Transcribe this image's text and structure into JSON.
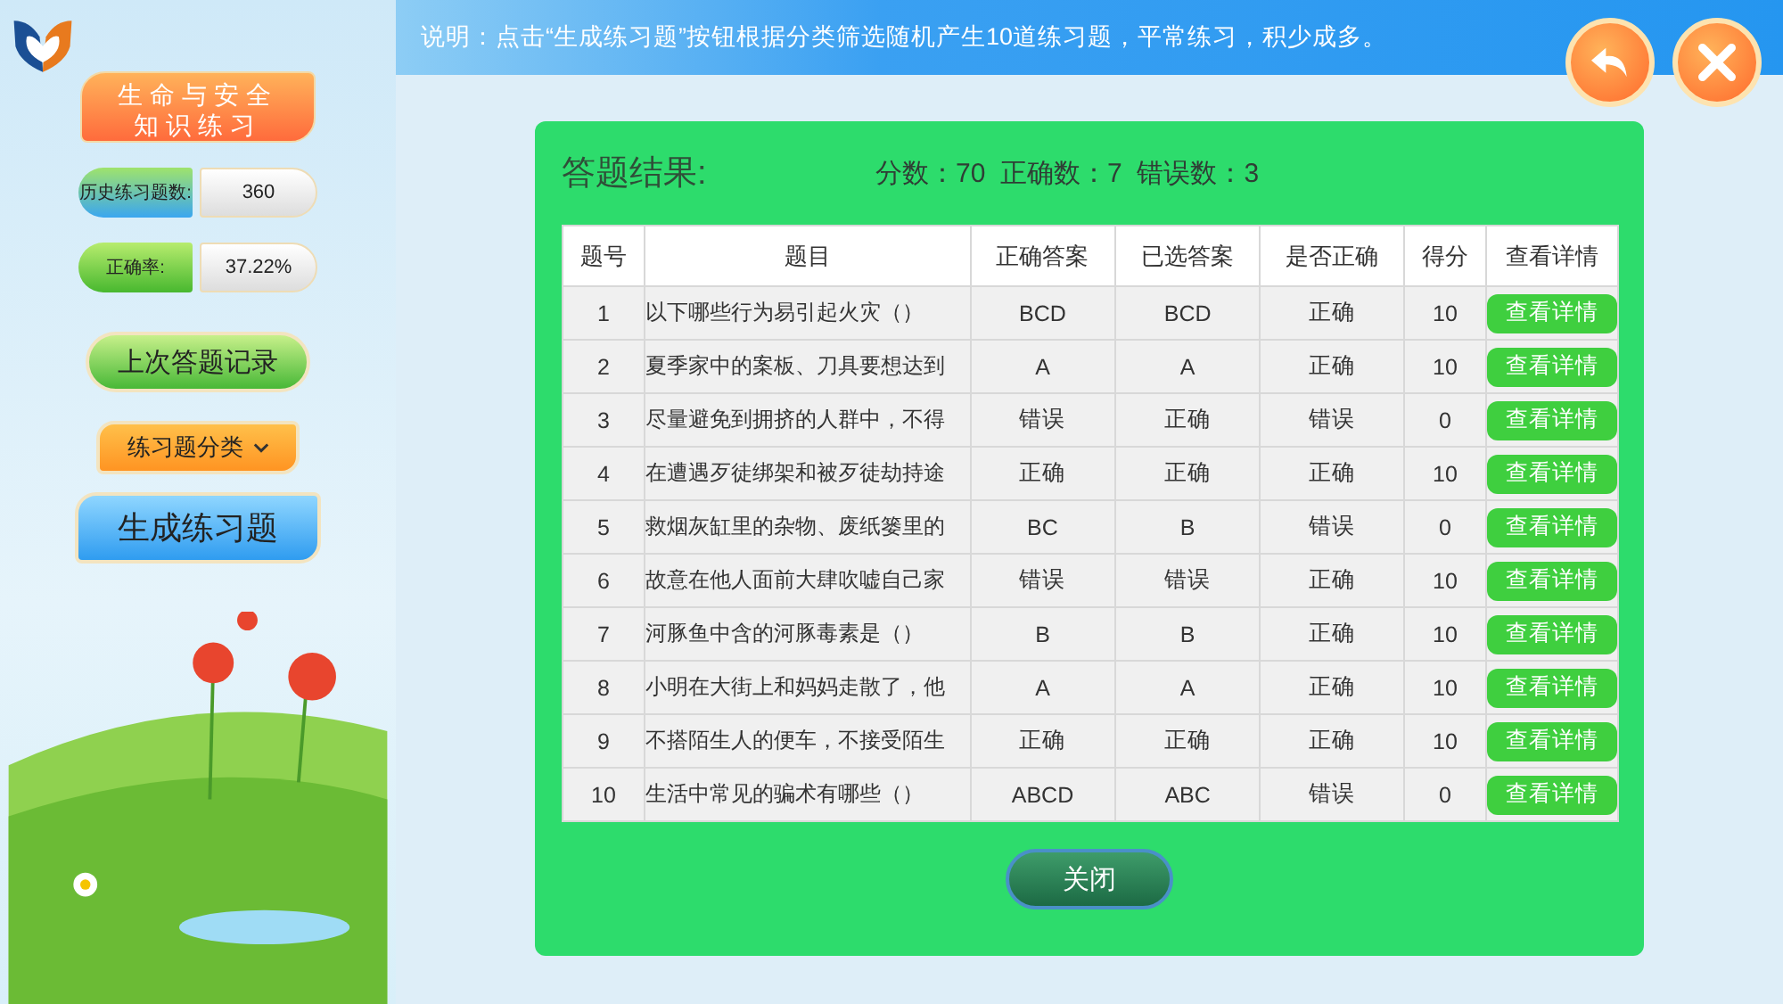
{
  "sidebar": {
    "title_lines": [
      "生命与安全",
      "知识练习"
    ],
    "stats": [
      {
        "label": "历史练习题数:",
        "value": "360",
        "kind": "blue"
      },
      {
        "label": "正确率:",
        "value": "37.22%",
        "kind": "green"
      }
    ],
    "buttons": [
      {
        "label": "上次答题记录",
        "kind": "green"
      },
      {
        "label": "练习题分类",
        "kind": "dropdown"
      },
      {
        "label": "生成练习题",
        "kind": "blue"
      }
    ]
  },
  "header": {
    "text": "说明：点击“生成练习题”按钮根据分类筛选随机产生10道练习题，平常练习，积少成多。"
  },
  "result": {
    "title": "答题结果:",
    "summary": "分数：70  正确数：7  错误数：3",
    "table": {
      "columns": [
        "题号",
        "题目",
        "正确答案",
        "已选答案",
        "是否正确",
        "得分",
        "查看详情"
      ],
      "rows": [
        {
          "no": "1",
          "question": "以下哪些行为易引起火灾（）",
          "answer": "BCD",
          "chosen": "BCD",
          "result": "正确",
          "score": "10",
          "action": "查看详情"
        },
        {
          "no": "2",
          "question": "夏季家中的案板、刀具要想达到",
          "answer": "A",
          "chosen": "A",
          "result": "正确",
          "score": "10",
          "action": "查看详情"
        },
        {
          "no": "3",
          "question": "尽量避免到拥挤的人群中，不得",
          "answer": "错误",
          "chosen": "正确",
          "result": "错误",
          "score": "0",
          "action": "查看详情"
        },
        {
          "no": "4",
          "question": "在遭遇歹徒绑架和被歹徒劫持途",
          "answer": "正确",
          "chosen": "正确",
          "result": "正确",
          "score": "10",
          "action": "查看详情"
        },
        {
          "no": "5",
          "question": "救烟灰缸里的杂物、废纸篓里的",
          "answer": "BC",
          "chosen": "B",
          "result": "错误",
          "score": "0",
          "action": "查看详情"
        },
        {
          "no": "6",
          "question": "故意在他人面前大肆吹嘘自己家",
          "answer": "错误",
          "chosen": "错误",
          "result": "正确",
          "score": "10",
          "action": "查看详情"
        },
        {
          "no": "7",
          "question": "河豚鱼中含的河豚毒素是（）",
          "answer": "B",
          "chosen": "B",
          "result": "正确",
          "score": "10",
          "action": "查看详情"
        },
        {
          "no": "8",
          "question": "小明在大街上和妈妈走散了，他",
          "answer": "A",
          "chosen": "A",
          "result": "正确",
          "score": "10",
          "action": "查看详情"
        },
        {
          "no": "9",
          "question": "不搭陌生人的便车，不接受陌生",
          "answer": "正确",
          "chosen": "正确",
          "result": "正确",
          "score": "10",
          "action": "查看详情"
        },
        {
          "no": "10",
          "question": "生活中常见的骗术有哪些（）",
          "answer": "ABCD",
          "chosen": "ABC",
          "result": "错误",
          "score": "0",
          "action": "查看详情"
        }
      ]
    },
    "close_button": "关闭"
  }
}
